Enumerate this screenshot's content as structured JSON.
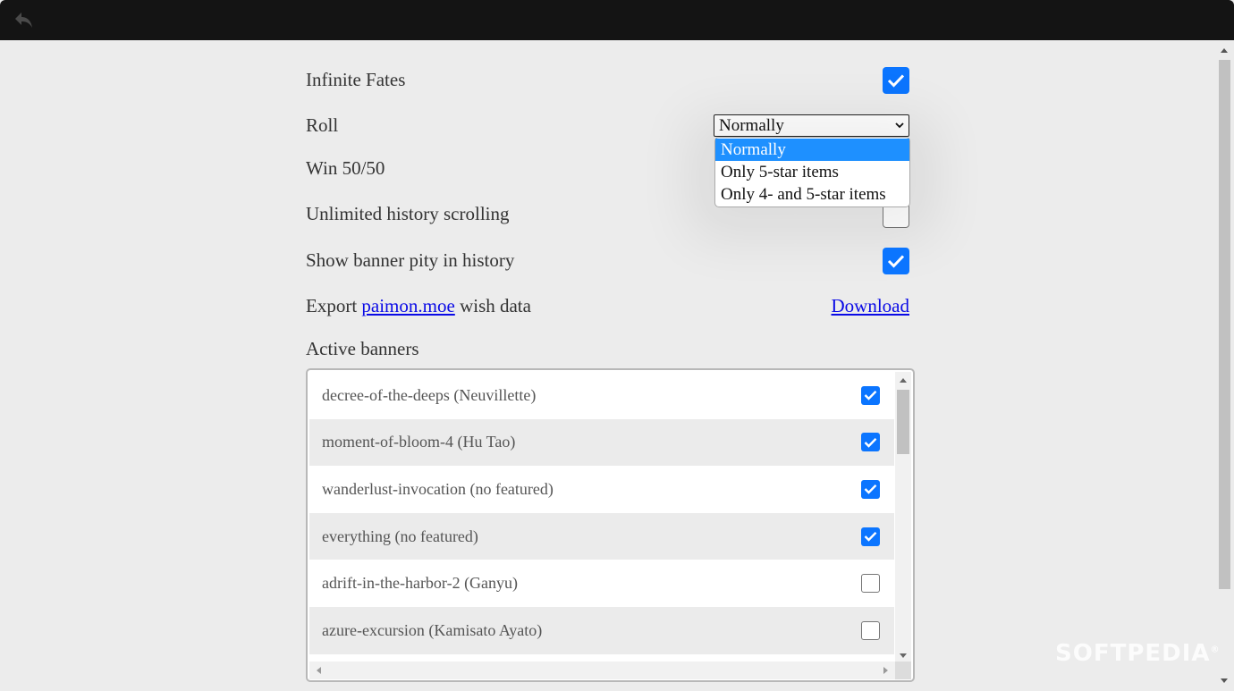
{
  "settings": {
    "infinite_fates": {
      "label": "Infinite Fates",
      "checked": true
    },
    "roll": {
      "label": "Roll",
      "selected": "Normally",
      "options": [
        "Normally",
        "Only 5-star items",
        "Only 4- and 5-star items"
      ]
    },
    "win_5050": {
      "label": "Win 50/50"
    },
    "unlimited_history": {
      "label": "Unlimited history scrolling",
      "checked": false
    },
    "show_pity": {
      "label": "Show banner pity in history",
      "checked": true
    },
    "export": {
      "prefix": "Export",
      "link": "paimon.moe",
      "suffix": "wish data",
      "download": "Download"
    }
  },
  "active_banners": {
    "label": "Active banners",
    "items": [
      {
        "name": "decree-of-the-deeps (Neuvillette)",
        "checked": true
      },
      {
        "name": "moment-of-bloom-4 (Hu Tao)",
        "checked": true
      },
      {
        "name": "wanderlust-invocation (no featured)",
        "checked": true
      },
      {
        "name": "everything (no featured)",
        "checked": true
      },
      {
        "name": "adrift-in-the-harbor-2 (Ganyu)",
        "checked": false
      },
      {
        "name": "azure-excursion (Kamisato Ayato)",
        "checked": false
      }
    ]
  },
  "watermark": "SOFTPEDIA",
  "colors": {
    "accent": "#0b75ff",
    "topbar": "#141414",
    "background": "#ececec"
  }
}
